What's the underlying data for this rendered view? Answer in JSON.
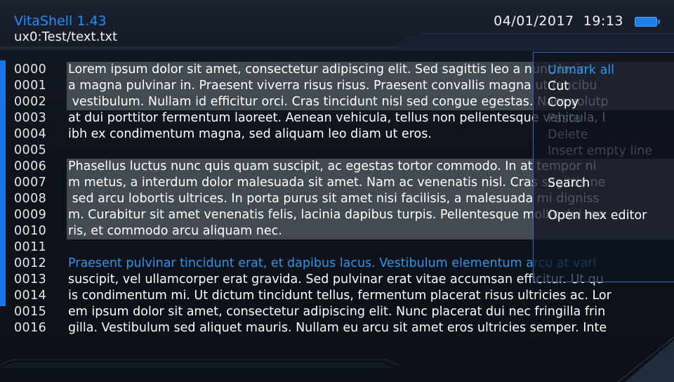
{
  "header": {
    "app_title": "VitaShell 1.43",
    "file_path": "ux0:Test/text.txt",
    "date": "04/01/2017",
    "time": "19:13"
  },
  "editor": {
    "lines": [
      {
        "no": "0000",
        "text": "Lorem ipsum dolor sit amet, consectetur adipiscing elit. Sed sagittis leo a nunc lacin",
        "marked": true,
        "highlight": false
      },
      {
        "no": "0001",
        "text": "a magna pulvinar in. Praesent viverra risus risus. Praesent convallis magna ut faucibu",
        "marked": true,
        "highlight": false
      },
      {
        "no": "0002",
        "text": " vestibulum. Nullam id efficitur orci. Cras tincidunt nisl sed congue egestas. Nam volutp",
        "marked": true,
        "highlight": false
      },
      {
        "no": "0003",
        "text": "at dui porttitor fermentum laoreet. Aenean vehicula, tellus non pellentesque vehicula, l",
        "marked": false,
        "highlight": false
      },
      {
        "no": "0004",
        "text": "ibh ex condimentum magna, sed aliquam leo diam ut eros.",
        "marked": false,
        "highlight": false
      },
      {
        "no": "0005",
        "text": "",
        "marked": false,
        "highlight": false
      },
      {
        "no": "0006",
        "text": "Phasellus luctus nunc quis quam suscipit, ac egestas tortor commodo. In at tempor ni",
        "marked": true,
        "highlight": false
      },
      {
        "no": "0007",
        "text": "m metus, a interdum dolor malesuada sit amet. Nam ac venenatis nisl. Cras sagittis ne",
        "marked": true,
        "highlight": false
      },
      {
        "no": "0008",
        "text": " sed arcu lobortis ultrices. In porta purus sit amet nisi facilisis, a malesuada mi digniss",
        "marked": true,
        "highlight": false
      },
      {
        "no": "0009",
        "text": "m. Curabitur sit amet venenatis felis, lacinia dapibus turpis. Pellentesque mollis dui ma",
        "marked": true,
        "highlight": false
      },
      {
        "no": "0010",
        "text": "ris, et commodo arcu aliquam nec.",
        "marked": true,
        "highlight": false
      },
      {
        "no": "0011",
        "text": "",
        "marked": false,
        "highlight": false
      },
      {
        "no": "0012",
        "text": "Praesent pulvinar tincidunt erat, et dapibus lacus. Vestibulum elementum arcu at vari",
        "marked": false,
        "highlight": true
      },
      {
        "no": "0013",
        "text": "suscipit, vel ullamcorper erat gravida. Sed pulvinar erat vitae accumsan efficitur. Ut qu",
        "marked": false,
        "highlight": false
      },
      {
        "no": "0014",
        "text": "is condimentum mi. Ut dictum tincidunt tellus, fermentum placerat risus ultricies ac. Lor",
        "marked": false,
        "highlight": false
      },
      {
        "no": "0015",
        "text": "em ipsum dolor sit amet, consectetur adipiscing elit. Nunc placerat dui nec fringilla frin",
        "marked": false,
        "highlight": false
      },
      {
        "no": "0016",
        "text": "gilla. Vestibulum sed aliquet mauris. Nullam eu arcu sit amet eros ultricies semper. Inte",
        "marked": false,
        "highlight": false
      }
    ]
  },
  "context_menu": {
    "items": [
      {
        "label": "Unmark all",
        "state": "selected"
      },
      {
        "label": "Cut",
        "state": "enabled"
      },
      {
        "label": "Copy",
        "state": "enabled"
      },
      {
        "label": "Paste",
        "state": "disabled"
      },
      {
        "label": "Delete",
        "state": "disabled"
      },
      {
        "label": "Insert empty line",
        "state": "disabled"
      },
      {
        "label": "",
        "state": "spacer"
      },
      {
        "label": "Search",
        "state": "enabled"
      },
      {
        "label": "",
        "state": "spacer"
      },
      {
        "label": "Open hex editor",
        "state": "enabled"
      }
    ]
  },
  "colors": {
    "accent": "#1e8fff",
    "selected_menu_item": "#2a97f0",
    "highlight_line": "#2b95ea",
    "marked_background": "#444a52",
    "battery": "#1e7fe8"
  }
}
